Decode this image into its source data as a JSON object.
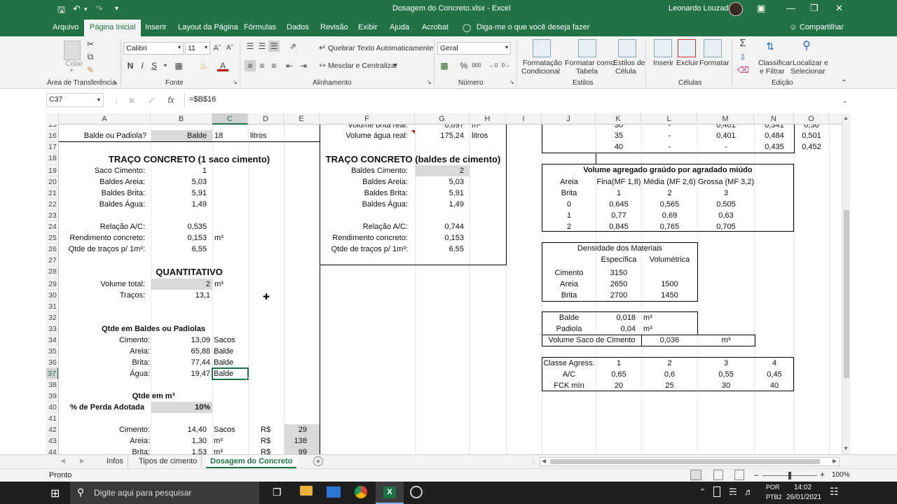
{
  "title_bar": {
    "doc_title": "Dosagem do Concreto.xlsx  -  Excel",
    "user": "Leonardo Louzada"
  },
  "ribbon_tabs": [
    "Arquivo",
    "Página Inicial",
    "Inserir",
    "Layout da Página",
    "Fórmulas",
    "Dados",
    "Revisão",
    "Exibir",
    "Ajuda",
    "Acrobat"
  ],
  "tell_me": "Diga-me o que você deseja fazer",
  "share": "Compartilhar",
  "ribbon": {
    "paste": "Colar",
    "clipboard": "Área de Transferência",
    "font_name": "Calibri",
    "font_size": "11",
    "font_group": "Fonte",
    "wrap_text": "Quebrar Texto Automaticamente",
    "merge_center": "Mesclar e Centralizar",
    "alignment_group": "Alinhamento",
    "number_format": "Geral",
    "number_group": "Número",
    "cond_format": [
      "Formatação",
      "Condicional"
    ],
    "format_table": [
      "Formatar como",
      "Tabela"
    ],
    "cell_styles": [
      "Estilos de",
      "Célula"
    ],
    "styles_group": "Estilos",
    "insert": "Inserir",
    "delete": "Excluir",
    "format": "Formatar",
    "cells_group": "Células",
    "sort_filter": [
      "Classificar",
      "e Filtrar"
    ],
    "find_select": [
      "Localizar e",
      "Selecionar"
    ],
    "editing_group": "Edição"
  },
  "formula_bar": {
    "name_box": "C37",
    "fx": "fx",
    "formula": "=$B$16"
  },
  "columns": [
    "A",
    "B",
    "C",
    "D",
    "E",
    "F",
    "G",
    "H",
    "I",
    "J",
    "K",
    "L",
    "M",
    "N",
    "O"
  ],
  "rows": [
    "15",
    "16",
    "17",
    "18",
    "19",
    "20",
    "21",
    "22",
    "23",
    "24",
    "25",
    "26",
    "27",
    "28",
    "29",
    "30",
    "31",
    "32",
    "33",
    "34",
    "35",
    "36",
    "37",
    "38",
    "39",
    "40",
    "41",
    "42",
    "43",
    "44"
  ],
  "left": {
    "r15": [
      "",
      "",
      "",
      "",
      ""
    ],
    "r16": [
      "Balde ou Padiola?",
      "Balde",
      "18",
      "litros"
    ],
    "r18": "TRAÇO CONCRETO (1 saco cimento)",
    "r19": [
      "Saco Cimento:",
      "1"
    ],
    "r20": [
      "Baldes Areia:",
      "5,03"
    ],
    "r21": [
      "Baldes Brita:",
      "5,91"
    ],
    "r22": [
      "Baldes Água:",
      "1,49"
    ],
    "r24": [
      "Relação A/C:",
      "0,535"
    ],
    "r25": [
      "Rendimento concreto:",
      "0,153",
      "m³"
    ],
    "r26": [
      "Qtde de traços p/ 1m³:",
      "6,55"
    ],
    "r28": "QUANTITATIVO",
    "r29": [
      "Volume total:",
      "2",
      "m³"
    ],
    "r30": [
      "Traços:",
      "13,1"
    ],
    "r33": "Qtde em Baldes ou Padiolas",
    "r34": [
      "Cimento:",
      "13,09",
      "Sacos"
    ],
    "r35": [
      "Areia:",
      "65,88",
      "Balde"
    ],
    "r36": [
      "Brita:",
      "77,44",
      "Balde"
    ],
    "r37": [
      "Água:",
      "19,47",
      "Balde"
    ],
    "r39": "Qtde em m³",
    "r40": [
      "% de Perda Adotada",
      "10%"
    ],
    "r42": [
      "Cimento:",
      "14,40",
      "Sacos",
      "R$",
      "29"
    ],
    "r43": [
      "Areia:",
      "1,30",
      "m³",
      "R$",
      "138"
    ],
    "r44": [
      "Brita:",
      "1,53",
      "m³",
      "R$",
      "99"
    ]
  },
  "middle": {
    "r15": [
      "Volume brita real:",
      "0,897",
      "m³"
    ],
    "r16": [
      "Volume água real:",
      "175,24",
      "litros"
    ],
    "r18": "TRAÇO CONCRETO (baldes de cimento)",
    "r19": [
      "Baldes Cimento:",
      "2"
    ],
    "r20": [
      "Baldes Areia:",
      "5,03"
    ],
    "r21": [
      "Baldes Brita:",
      "5,91"
    ],
    "r22": [
      "Baldes Água:",
      "1,49"
    ],
    "r24": [
      "Relação A/C:",
      "0,744"
    ],
    "r25": [
      "Rendimento concreto:",
      "0,153"
    ],
    "r26": [
      "Qtde de traços p/ 1m³:",
      "6,55"
    ]
  },
  "right": {
    "r15": [
      "30",
      "-",
      "0,401",
      "0,341",
      "0,36"
    ],
    "r16": [
      "35",
      "-",
      "0,401",
      "0,484",
      "0,501"
    ],
    "r17": [
      "40",
      "-",
      "-",
      "0,435",
      "0,452"
    ],
    "vol_title": "Volume agregado graúdo por agradado miúdo",
    "vol_h1": [
      "Areia",
      "Fina(MF 1,8)",
      "Média (MF 2,6)",
      "Grossa (MF 3,2)"
    ],
    "vol_h2": [
      "Brita",
      "1",
      "2",
      "3"
    ],
    "vol_rows": [
      [
        "0",
        "0,645",
        "0,565",
        "0,505"
      ],
      [
        "1",
        "0,77",
        "0,69",
        "0,63"
      ],
      [
        "2",
        "0,845",
        "0,765",
        "0,705"
      ]
    ],
    "dens_title": "Densidade dos Materiais",
    "dens_h": [
      "Específica",
      "Volumétrica"
    ],
    "dens_rows": [
      [
        "Cimento",
        "3150",
        ""
      ],
      [
        "Areia",
        "2650",
        "1500"
      ],
      [
        "Brita",
        "2700",
        "1450"
      ]
    ],
    "balde": [
      "Balde",
      "0,018",
      "m³"
    ],
    "padiola": [
      "Padiola",
      "0,04",
      "m³"
    ],
    "saco": [
      "Volume Saco de Cimento",
      "0,036",
      "m³"
    ],
    "classe": [
      [
        "Classe Agress.",
        "1",
        "2",
        "3",
        "4"
      ],
      [
        "A/C",
        "0,65",
        "0,6",
        "0,55",
        "0,45"
      ],
      [
        "FCK mín",
        "20",
        "25",
        "30",
        "40"
      ]
    ]
  },
  "sheets": [
    "Infos",
    "Tipos de cimento",
    "Dosagem do Concreto"
  ],
  "status": {
    "ready": "Pronto",
    "zoom": "100%"
  },
  "taskbar": {
    "search": "Digite aqui para pesquisar",
    "lang": [
      "POR",
      "PTB2"
    ],
    "time": "14:02",
    "date": "26/01/2021"
  }
}
